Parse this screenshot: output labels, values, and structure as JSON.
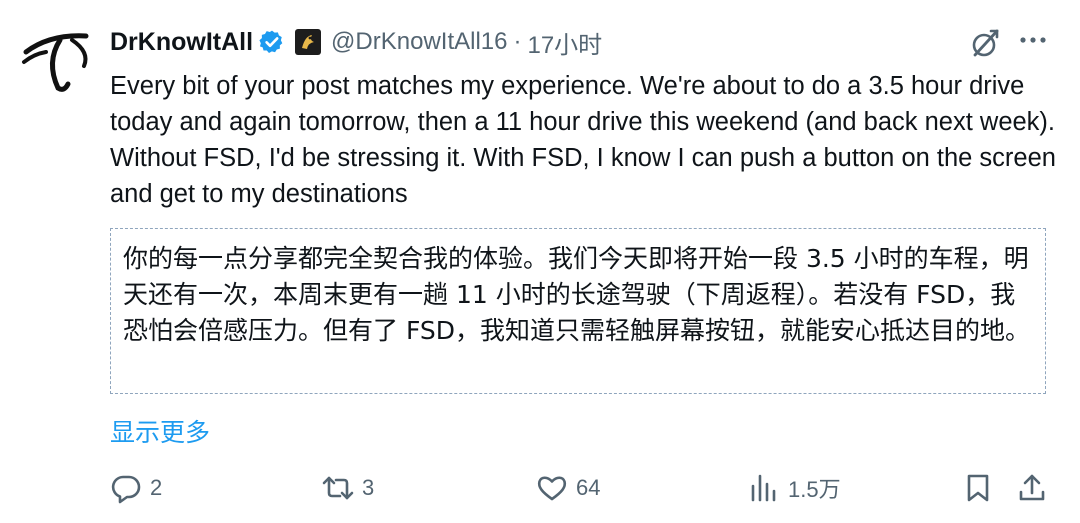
{
  "post": {
    "author_name": "DrKnowItAll",
    "handle": "@DrKnowItAll16",
    "separator": "·",
    "time": "17小时",
    "text": "Every bit of your post matches my experience. We're about to do a 3.5 hour drive today and again tomorrow, then a 11 hour drive this weekend (and back next week). Without FSD, I'd be stressing it. With FSD, I know I can push a button on the screen and get to my destinations",
    "translation": "你的每一点分享都完全契合我的体验。我们今天即将开始一段 3.5 小时的车程，明天还有一次，本周末更有一趟 11 小时的长途驾驶（下周返程）。若没有 FSD，我恐怕会倍感压力。但有了 FSD，我知道只需轻触屏幕按钮，就能安心抵达目的地。",
    "show_more": "显示更多"
  },
  "actions": {
    "replies": "2",
    "reposts": "3",
    "likes": "64",
    "views": "1.5万"
  },
  "icons": {
    "verified": "verified-badge-icon",
    "affiliate": "affiliate-badge-icon",
    "grok": "grok-icon",
    "more": "more-icon",
    "reply": "reply-icon",
    "repost": "repost-icon",
    "like": "heart-icon",
    "views": "views-icon",
    "bookmark": "bookmark-icon",
    "share": "share-icon"
  },
  "colors": {
    "accent": "#1d9bf0",
    "secondary": "#536471",
    "text": "#0f1419",
    "translation_border": "#8fa5bd"
  }
}
